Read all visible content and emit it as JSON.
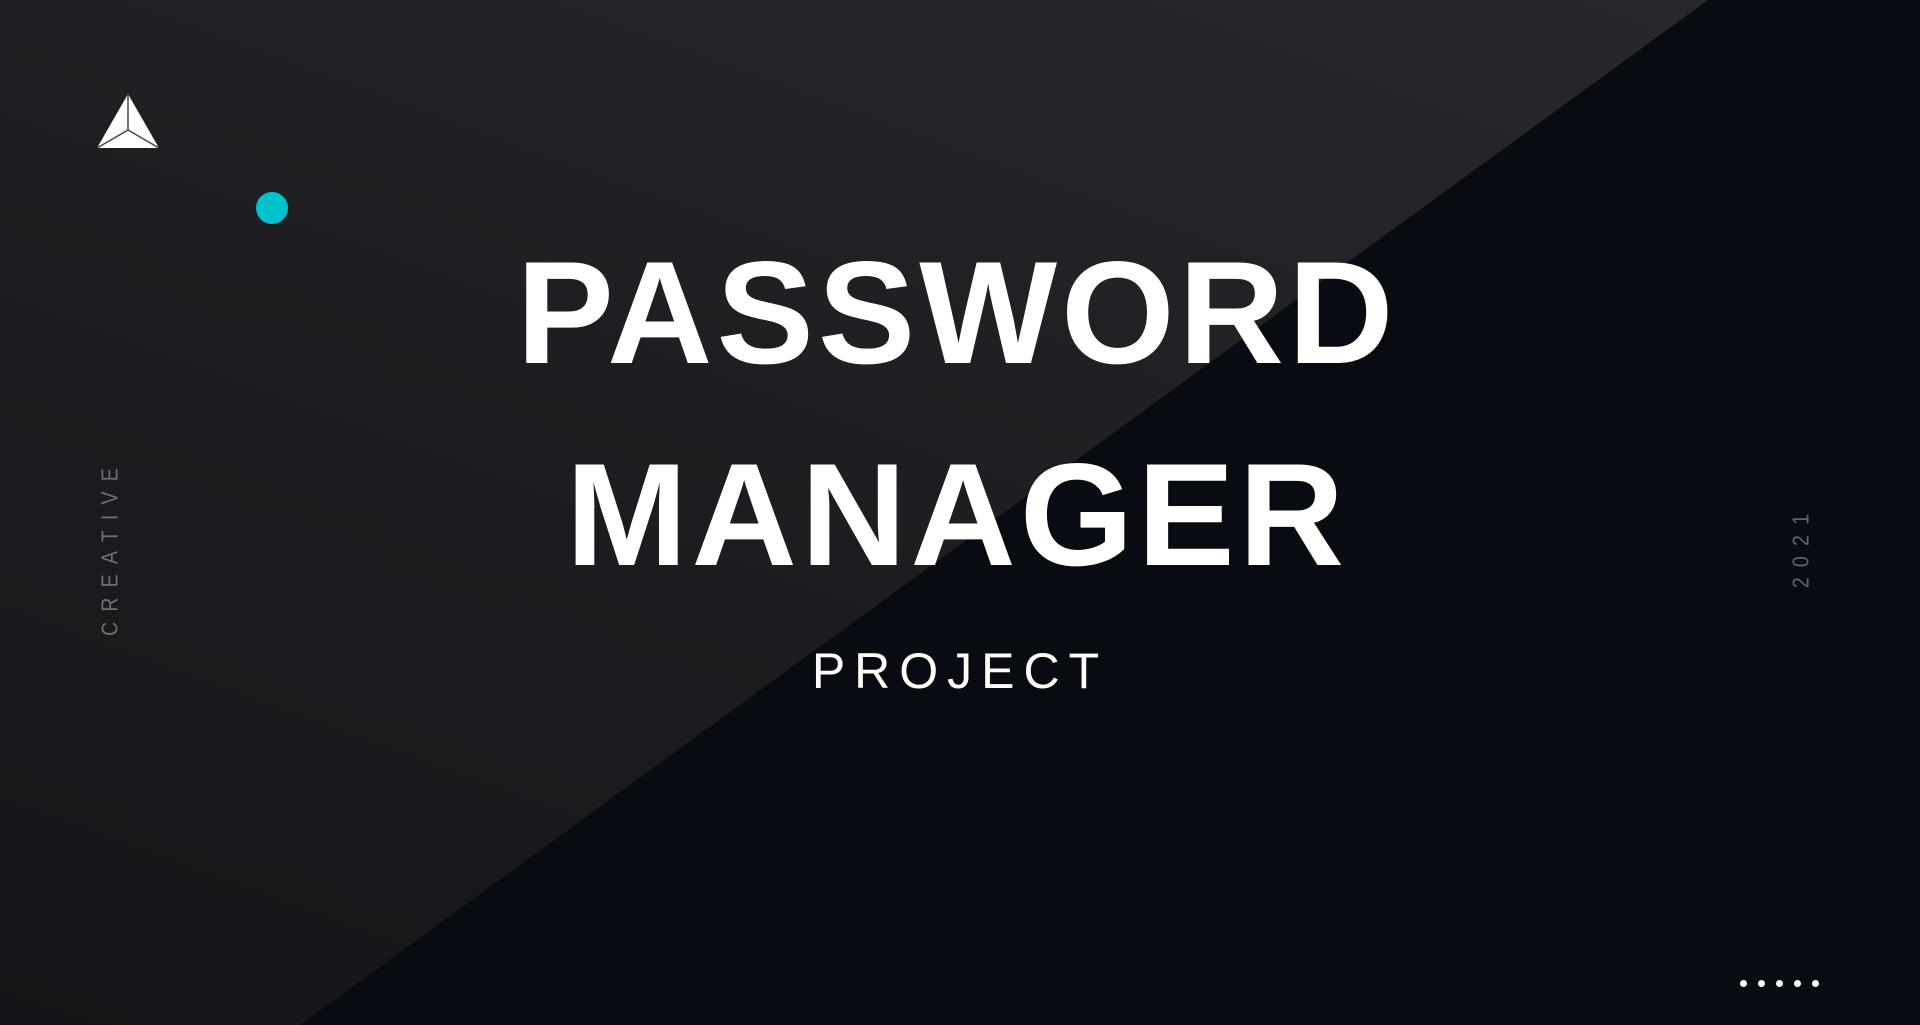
{
  "slide": {
    "title_line1": "PASSWORD",
    "title_line2": "MANAGER",
    "subtitle": "PROJECT",
    "side_left": "CREATIVE",
    "side_right": "2021",
    "logo_icon": "pyramid-logo-icon",
    "pager_dots": 5,
    "colors": {
      "accent": "#00c2cc",
      "background_dark": "#080b12",
      "background_light": "#1e1f22",
      "text": "#ffffff",
      "muted_text": "#6b6e73"
    }
  }
}
